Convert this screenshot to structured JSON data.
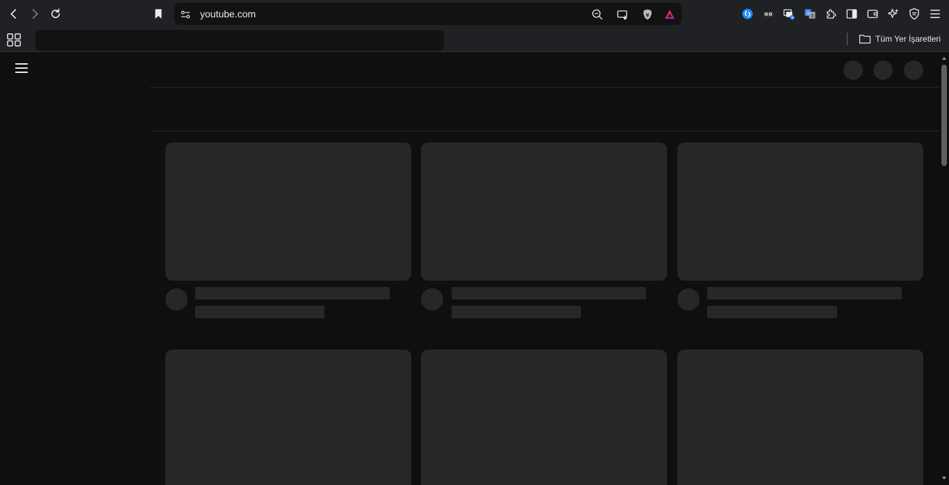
{
  "browser": {
    "url": "youtube.com",
    "bookmarks_folder_label": "Tüm Yer İşaretleri"
  },
  "icons": {
    "back": "back-arrow-icon",
    "forward": "forward-arrow-icon",
    "reload": "reload-icon",
    "bookmark": "bookmark-icon",
    "site_settings": "site-settings-icon",
    "zoom": "zoom-out-icon",
    "cast": "cast-icon",
    "brave_shield": "brave-shield-icon",
    "brave_rewards": "brave-rewards-icon",
    "apps": "apps-grid-icon",
    "folder": "folder-icon",
    "menu": "hamburger-menu-icon"
  },
  "colors": {
    "toolbar_bg": "#202124",
    "page_bg": "#0f0f0f",
    "skeleton": "#272727",
    "accent_blue": "#1a73e8"
  }
}
